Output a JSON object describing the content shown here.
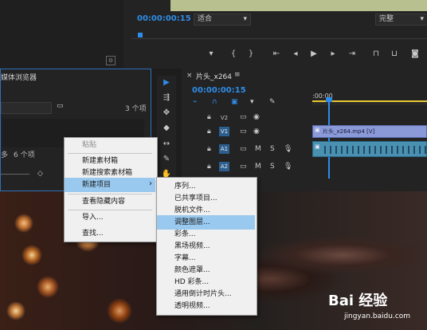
{
  "program_monitor": {
    "timecode": "00:00:00:15",
    "fit_select": "适合",
    "quality_select": "完整"
  },
  "project_panel": {
    "title": "媒体浏览器",
    "item_count_top": "3 个项",
    "item_count_bottom": "6 个项",
    "bottom_prefix": "多"
  },
  "timeline": {
    "sequence_tab": "片头_x264",
    "timecode": "00:00:00:15",
    "ruler_start": ":00:00",
    "clip_name": "片头_x264.mp4 [V]",
    "tracks": [
      {
        "label": "V2",
        "state": "dim"
      },
      {
        "label": "V1",
        "state": "on"
      },
      {
        "label": "A1",
        "state": "on"
      },
      {
        "label": "A2",
        "state": "on"
      }
    ],
    "audio_buttons": [
      "M",
      "S"
    ]
  },
  "context_menu": {
    "items": [
      "粘贴",
      "新建素材箱",
      "新建搜索素材箱",
      "新建项目",
      "查看隐藏内容",
      "导入...",
      "查找..."
    ],
    "submenu_arrow": "›"
  },
  "submenu": {
    "items": [
      "序列...",
      "已共享项目...",
      "脱机文件...",
      "调整图层...",
      "彩条...",
      "黑场视频...",
      "字幕...",
      "颜色遮罩...",
      "HD 彩条...",
      "通用倒计时片头...",
      "透明视频..."
    ],
    "highlighted": "调整图层..."
  },
  "watermark": {
    "logo": "Bai 经验",
    "url": "jingyan.baidu.com"
  },
  "colors": {
    "accent_blue": "#2f8ce8",
    "menu_highlight": "#99c9ef"
  }
}
